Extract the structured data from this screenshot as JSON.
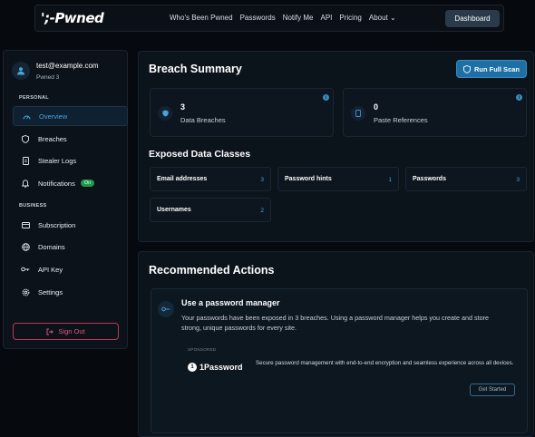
{
  "topbar": {
    "logo": "';-Pwned",
    "nav": [
      "Who's Been Pwned",
      "Passwords",
      "Notify Me",
      "API",
      "Pricing",
      "About ⌄"
    ],
    "dashboard": "Dashboard"
  },
  "sidebar": {
    "email": "test@example.com",
    "pwned": "Pwned 3",
    "personal_label": "PERSONAL",
    "business_label": "BUSINESS",
    "personal": [
      {
        "label": "Overview",
        "icon": "dashboard-icon"
      },
      {
        "label": "Breaches",
        "icon": "shield-icon"
      },
      {
        "label": "Stealer Logs",
        "icon": "document-icon"
      },
      {
        "label": "Notifications",
        "icon": "bell-icon",
        "badge": "On"
      }
    ],
    "business": [
      {
        "label": "Subscription",
        "icon": "card-icon"
      },
      {
        "label": "Domains",
        "icon": "globe-icon"
      },
      {
        "label": "API Key",
        "icon": "key-icon"
      },
      {
        "label": "Settings",
        "icon": "gear-icon"
      }
    ],
    "signout": "Sign Out"
  },
  "summary": {
    "title": "Breach Summary",
    "scan": "Run Full Scan",
    "stats": [
      {
        "num": "3",
        "label": "Data Breaches"
      },
      {
        "num": "0",
        "label": "Paste References"
      }
    ],
    "classes_title": "Exposed Data Classes",
    "classes": [
      {
        "name": "Email addresses",
        "count": "3"
      },
      {
        "name": "Password hints",
        "count": "1"
      },
      {
        "name": "Passwords",
        "count": "3"
      },
      {
        "name": "Usernames",
        "count": "2"
      }
    ]
  },
  "actions": {
    "title": "Recommended Actions",
    "item_title": "Use a password manager",
    "item_desc": "Your passwords have been exposed in 3 breaches. Using a password manager helps you create and store strong, unique passwords for every site.",
    "sponsored": "SPONSORED",
    "sponsor_name": "1Password",
    "sponsor_desc": "Secure password management with end-to-end encryption and seamless experience across all devices.",
    "cta": "Get Started"
  }
}
